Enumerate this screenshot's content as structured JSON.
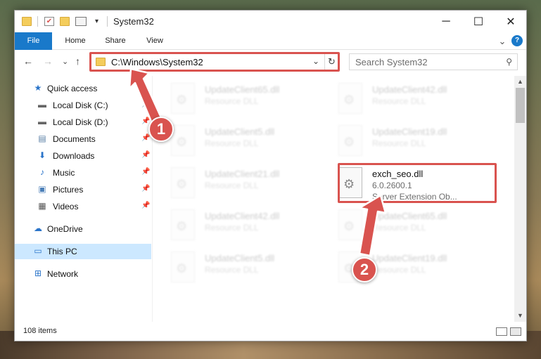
{
  "window": {
    "title": "System32",
    "minimize_glyph": "─",
    "maximize_glyph": "☐",
    "close_glyph": "✕"
  },
  "ribbon": {
    "tabs": [
      "File",
      "Home",
      "Share",
      "View"
    ],
    "expand_glyph": "⌄",
    "help_glyph": "?"
  },
  "nav": {
    "back_glyph": "←",
    "forward_glyph": "→",
    "recent_glyph": "⌄",
    "up_glyph": "↑",
    "address": "C:\\Windows\\System32",
    "address_chevron": "⌄",
    "refresh_glyph": "↻",
    "search_placeholder": "Search System32",
    "search_glyph": "⚲"
  },
  "sidebar": {
    "items": [
      {
        "label": "Quick access",
        "icon": "star-icon",
        "glyph": "★",
        "pinned": false
      },
      {
        "label": "Local Disk (C:)",
        "icon": "drive-icon",
        "glyph": "▬",
        "pinned": true
      },
      {
        "label": "Local Disk (D:)",
        "icon": "drive-icon",
        "glyph": "▬",
        "pinned": true
      },
      {
        "label": "Documents",
        "icon": "documents-icon",
        "glyph": "▤",
        "pinned": true
      },
      {
        "label": "Downloads",
        "icon": "downloads-icon",
        "glyph": "⬇",
        "pinned": true
      },
      {
        "label": "Music",
        "icon": "music-icon",
        "glyph": "♪",
        "pinned": true
      },
      {
        "label": "Pictures",
        "icon": "pictures-icon",
        "glyph": "▣",
        "pinned": true
      },
      {
        "label": "Videos",
        "icon": "videos-icon",
        "glyph": "▦",
        "pinned": true
      },
      {
        "label": "OneDrive",
        "icon": "cloud-icon",
        "glyph": "☁",
        "pinned": false
      },
      {
        "label": "This PC",
        "icon": "computer-icon",
        "glyph": "▭",
        "pinned": false
      },
      {
        "label": "Network",
        "icon": "network-icon",
        "glyph": "⊞",
        "pinned": false
      }
    ],
    "pin_glyph": "📌"
  },
  "files": [
    {
      "name": "UpdateClient65.dll",
      "type": "Resource DLL",
      "faded": true
    },
    {
      "name": "UpdateClient42.dll",
      "type": "Resource DLL",
      "faded": true
    },
    {
      "name": "UpdateClient5.dll",
      "type": "Resource DLL",
      "faded": true
    },
    {
      "name": "UpdateClient19.dll",
      "type": "Resource DLL",
      "faded": true
    },
    {
      "name": "UpdateClient21.dll",
      "type": "Resource DLL",
      "faded": true
    },
    {
      "name": "exch_seo.dll",
      "type": "6.0.2600.1",
      "description": "Server Extension Ob...",
      "faded": false
    },
    {
      "name": "UpdateClient42.dll",
      "type": "Resource DLL",
      "faded": true
    },
    {
      "name": "UpdateClient65.dll",
      "type": "Resource DLL",
      "faded": true
    },
    {
      "name": "UpdateClient5.dll",
      "type": "Resource DLL",
      "faded": true
    },
    {
      "name": "UpdateClient19.dll",
      "type": "Resource DLL",
      "faded": true
    }
  ],
  "file_icon_glyph": "⚙",
  "status": {
    "item_count": "108 items"
  },
  "callouts": [
    "1",
    "2"
  ],
  "colors": {
    "accent": "#1979ca",
    "highlight": "#d9534f",
    "selected": "#cce8ff",
    "folder": "#f4cd5c"
  }
}
